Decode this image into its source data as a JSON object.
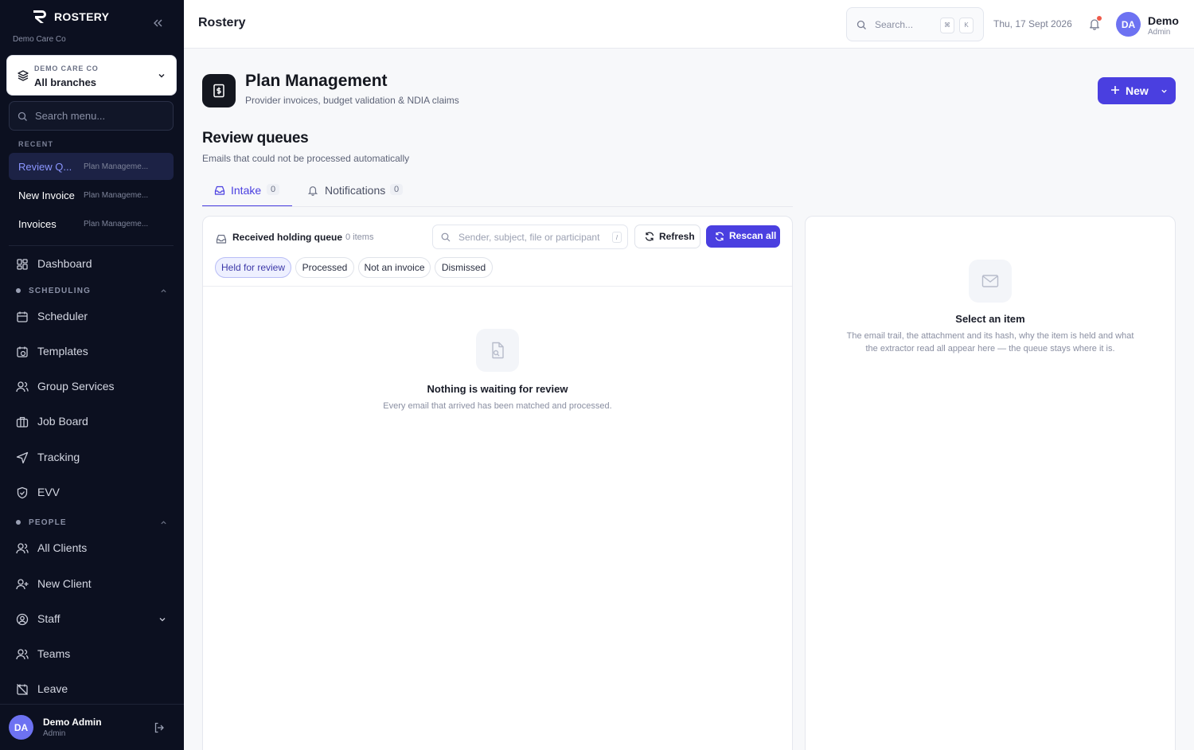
{
  "sidebar": {
    "brand": "ROSTERY",
    "org": "Demo Care Co",
    "branch_eyebrow": "DEMO CARE CO",
    "branch_value": "All branches",
    "search_placeholder": "Search menu...",
    "recent_label": "RECENT",
    "recent": [
      {
        "title": "Review Q...",
        "section": "Plan Manageme..."
      },
      {
        "title": "New Invoice",
        "section": "Plan Manageme..."
      },
      {
        "title": "Invoices",
        "section": "Plan Manageme..."
      }
    ],
    "dashboard": "Dashboard",
    "scheduling_label": "SCHEDULING",
    "scheduling_items": [
      "Scheduler",
      "Templates",
      "Group Services",
      "Job Board",
      "Tracking",
      "EVV"
    ],
    "people_label": "PEOPLE",
    "people_items": [
      "All Clients",
      "New Client",
      "Staff",
      "Teams",
      "Leave"
    ],
    "user_initials": "DA",
    "user_name": "Demo Admin",
    "user_role": "Admin"
  },
  "topbar": {
    "title": "Rostery",
    "search_placeholder": "Search...",
    "kbd_cmd": "⌘",
    "kbd_k": "K",
    "date": "Thu, 17 Sept 2026",
    "user_initials": "DA",
    "user_name": "Demo",
    "user_role": "Admin"
  },
  "page": {
    "title": "Plan Management",
    "subtitle": "Provider invoices, budget validation & NDIA claims",
    "new_button": "New",
    "section_title": "Review queues",
    "section_subtitle": "Emails that could not be processed automatically",
    "tabs": [
      {
        "label": "Intake",
        "count": "0"
      },
      {
        "label": "Notifications",
        "count": "0"
      }
    ]
  },
  "queue": {
    "title": "Received holding queue",
    "count": "0 items",
    "search_placeholder": "Sender, subject, file or participant",
    "search_kbd": "/",
    "refresh": "Refresh",
    "rescan": "Rescan all",
    "filters": [
      "Held for review",
      "Processed",
      "Not an invoice",
      "Dismissed"
    ],
    "empty_title": "Nothing is waiting for review",
    "empty_subtitle": "Every email that arrived has been matched and processed."
  },
  "detail": {
    "empty_title": "Select an item",
    "empty_line1": "The email trail, the attachment and its hash, why the item is held and what",
    "empty_line2": "the extractor read all appear here — the queue stays where it is."
  },
  "colors": {
    "accent": "#4a3fe0",
    "sidebar_bg": "#0c1020",
    "avatar": "#6d72f2",
    "notification_dot": "#ef5a4a"
  }
}
